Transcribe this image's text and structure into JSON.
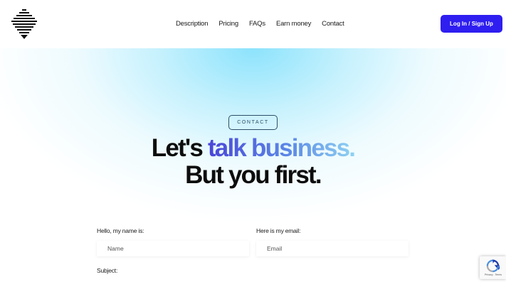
{
  "nav": {
    "items": [
      "Description",
      "Pricing",
      "FAQs",
      "Earn money",
      "Contact"
    ],
    "login_label": "Log In / Sign Up"
  },
  "hero": {
    "badge": "CONTACT",
    "headline_part1": "Let's ",
    "headline_highlight": "talk business.",
    "headline_line2": "But you first."
  },
  "form": {
    "name_label": "Hello, my name is:",
    "name_placeholder": "Name",
    "email_label": "Here is my email:",
    "email_placeholder": "Email",
    "subject_label": "Subject:"
  },
  "recaptcha": {
    "links": "Privacy - Terms"
  },
  "colors": {
    "accent": "#2f1ef0",
    "badge_border": "#2d4f68",
    "hero_glow": "#78defc"
  },
  "icons": {
    "logo": "layered-chevron-logo",
    "recaptcha": "recaptcha-icon"
  }
}
